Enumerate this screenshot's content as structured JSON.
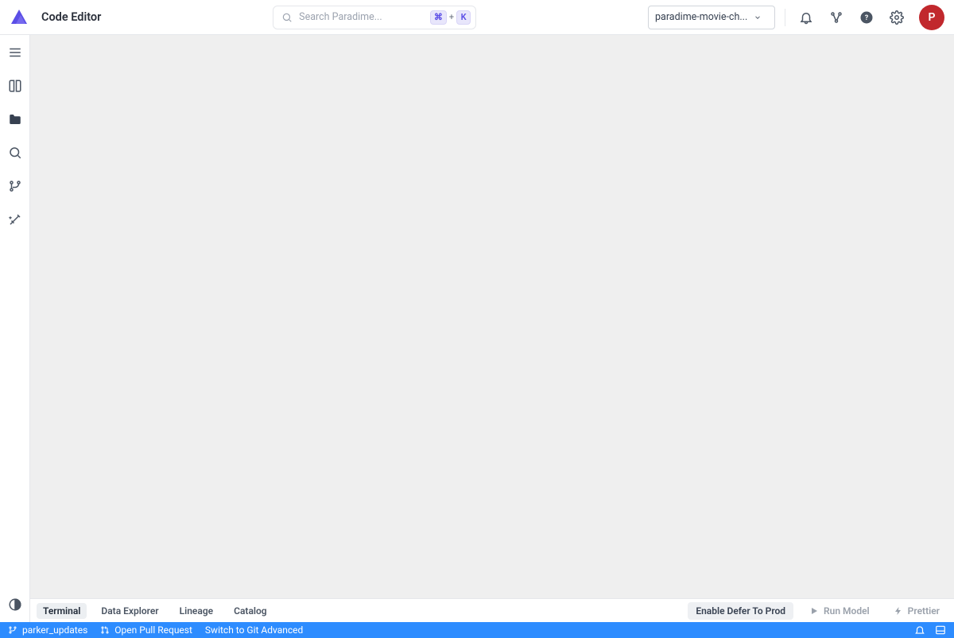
{
  "header": {
    "title": "Code Editor",
    "search": {
      "placeholder": "Search Paradime...",
      "shortcut_key_1": "⌘",
      "shortcut_plus": "+",
      "shortcut_key_2": "K"
    },
    "workspace": {
      "selected_label": "paradime-movie-ch..."
    },
    "avatar_initial": "P"
  },
  "panel": {
    "tabs": [
      {
        "label": "Terminal",
        "active": true
      },
      {
        "label": "Data Explorer",
        "active": false
      },
      {
        "label": "Lineage",
        "active": false
      },
      {
        "label": "Catalog",
        "active": false
      }
    ],
    "buttons": {
      "enable_defer": "Enable Defer To Prod",
      "run_model": "Run Model",
      "prettier": "Prettier"
    }
  },
  "status": {
    "branch": "parker_updates",
    "open_pr": "Open Pull Request",
    "switch_git": "Switch to Git Advanced"
  }
}
